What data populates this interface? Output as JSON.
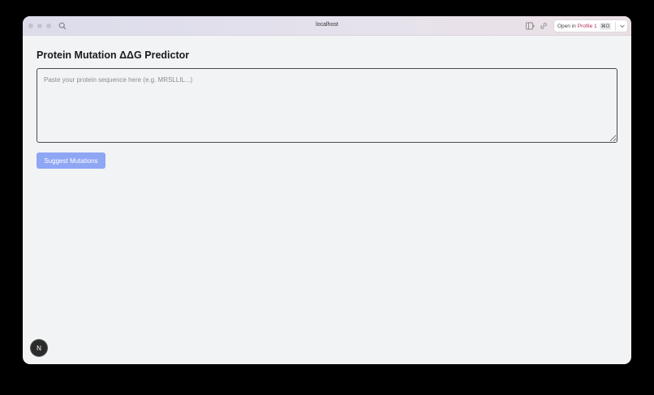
{
  "browser": {
    "url": "localhost",
    "open_in_label": "Open in",
    "profile_label": "Profile 1",
    "shortcut": "⌘O"
  },
  "page": {
    "title": "Protein Mutation ΔΔG Predictor",
    "sequence_placeholder": "Paste your protein sequence here (e.g. MRSLLIL...)",
    "sequence_value": "",
    "suggest_button_label": "Suggest Mutations"
  },
  "dev_badge": {
    "label": "N"
  },
  "colors": {
    "accent_button": "#8fa6f5",
    "page_background": "#f2f3f5",
    "profile_text": "#b32d5e"
  }
}
